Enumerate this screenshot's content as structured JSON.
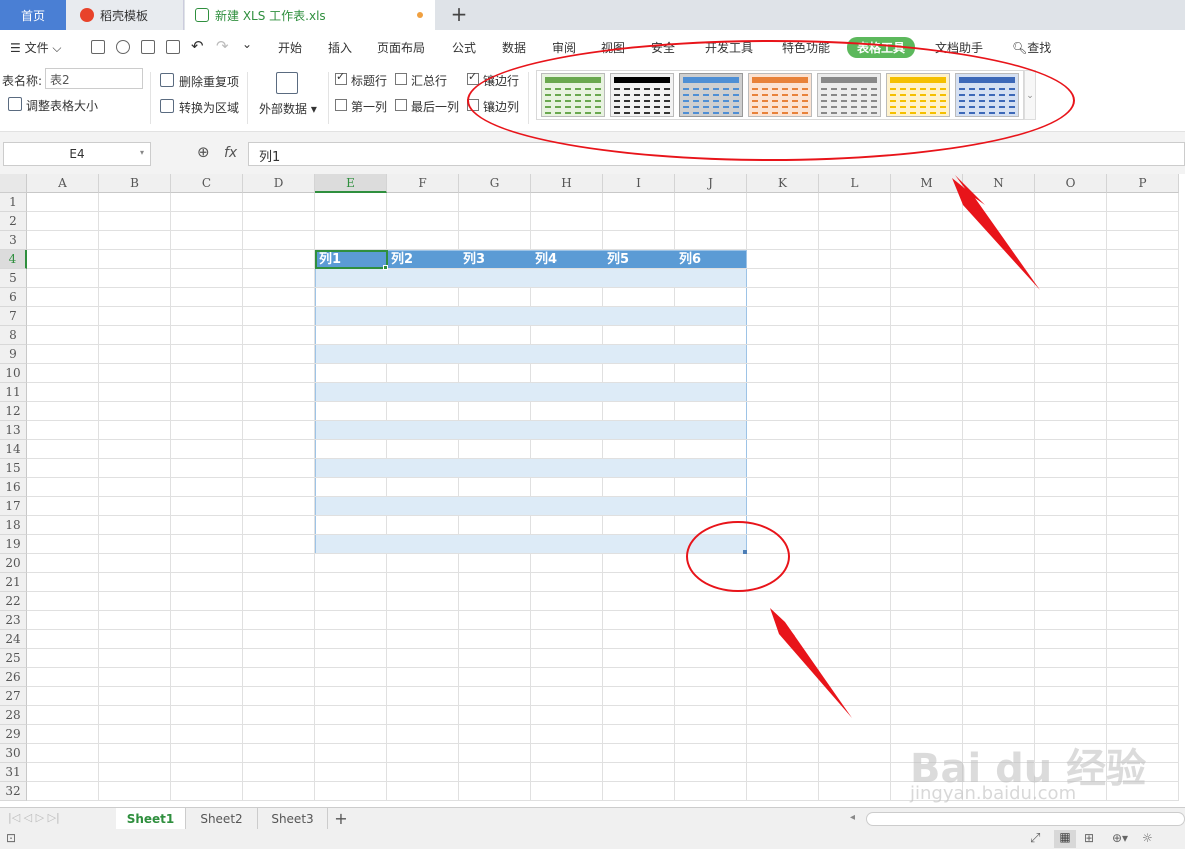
{
  "tabs": {
    "home": "首页",
    "template": "稻壳模板",
    "file": "新建 XLS 工作表.xls",
    "new_tab": "+"
  },
  "menu": {
    "file": "文件",
    "items": [
      "开始",
      "插入",
      "页面布局",
      "公式",
      "数据",
      "审阅",
      "视图",
      "安全",
      "开发工具",
      "特色功能",
      "表格工具",
      "文档助手"
    ],
    "search": "查找"
  },
  "ribbon": {
    "table_name_label": "表名称:",
    "table_name_value": "表2",
    "resize_table": "调整表格大小",
    "remove_duplicates": "删除重复项",
    "convert_to_range": "转换为区域",
    "external_data": "外部数据",
    "options": [
      {
        "label": "标题行",
        "checked": true
      },
      {
        "label": "汇总行",
        "checked": false
      },
      {
        "label": "镶边行",
        "checked": true
      },
      {
        "label": "第一列",
        "checked": false
      },
      {
        "label": "最后一列",
        "checked": false
      },
      {
        "label": "镶边列",
        "checked": false
      }
    ],
    "styles": [
      {
        "color": "#6aa84f",
        "fill": "#e8f3e0",
        "selected": false
      },
      {
        "color": "#000000",
        "fill": "#f2f2f2",
        "selected": false
      },
      {
        "color": "#4f8fd4",
        "fill": "#dce9f6",
        "selected": true
      },
      {
        "color": "#e8823a",
        "fill": "#fbe3d3",
        "selected": false
      },
      {
        "color": "#888888",
        "fill": "#ececec",
        "selected": false
      },
      {
        "color": "#f5c000",
        "fill": "#fff2cc",
        "selected": false
      },
      {
        "color": "#3c68b8",
        "fill": "#d5e0f2",
        "selected": false
      }
    ]
  },
  "formula_bar": {
    "cell_ref": "E4",
    "fx": "fx",
    "content": "列1"
  },
  "grid": {
    "columns": [
      "A",
      "B",
      "C",
      "D",
      "E",
      "F",
      "G",
      "H",
      "I",
      "J",
      "K",
      "L",
      "M",
      "N",
      "O",
      "P"
    ],
    "active_column": "E",
    "rows": [
      "1",
      "2",
      "3",
      "4",
      "5",
      "6",
      "7",
      "8",
      "9",
      "10",
      "11",
      "12",
      "13",
      "14",
      "15",
      "16",
      "17",
      "18",
      "19",
      "20",
      "21",
      "22",
      "23",
      "24",
      "25",
      "26",
      "27",
      "28",
      "29",
      "30",
      "31",
      "32"
    ],
    "active_row": "4",
    "table_headers": [
      "列1",
      "列2",
      "列3",
      "列4",
      "列5",
      "列6"
    ],
    "header_color": "#5b9bd5",
    "band_color": "#ddebf7"
  },
  "sheets": {
    "tabs": [
      "Sheet1",
      "Sheet2",
      "Sheet3"
    ],
    "active": "Sheet1",
    "add": "+"
  },
  "watermark": {
    "brand": "Bai du 经验",
    "url": "jingyan.baidu.com"
  }
}
